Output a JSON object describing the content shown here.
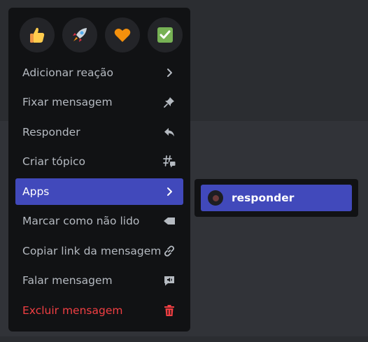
{
  "colors": {
    "background": "#313338",
    "band": "#2b2d31",
    "menu_bg": "#111214",
    "accent": "#4149bb",
    "danger": "#f23f43",
    "text": "#b5bac1"
  },
  "reactions": [
    {
      "icon": "thumbs-up-emoji"
    },
    {
      "icon": "rocket-emoji"
    },
    {
      "icon": "orange-heart-emoji"
    },
    {
      "icon": "check-mark-button-emoji"
    }
  ],
  "menu": {
    "items": [
      {
        "label": "Adicionar reação",
        "icon": "chevron-right-icon"
      },
      {
        "label": "Fixar mensagem",
        "icon": "pin-icon"
      },
      {
        "label": "Responder",
        "icon": "reply-icon"
      },
      {
        "label": "Criar tópico",
        "icon": "thread-icon"
      },
      {
        "label": "Apps",
        "icon": "chevron-right-icon",
        "active": true
      },
      {
        "label": "Marcar como não lido",
        "icon": "mark-unread-icon"
      },
      {
        "label": "Copiar link da mensagem",
        "icon": "link-icon"
      },
      {
        "label": "Falar mensagem",
        "icon": "speak-icon"
      },
      {
        "label": "Excluir mensagem",
        "icon": "trash-icon",
        "danger": true
      }
    ]
  },
  "submenu": {
    "items": [
      {
        "label": "responder",
        "icon": "app-avatar"
      }
    ]
  }
}
